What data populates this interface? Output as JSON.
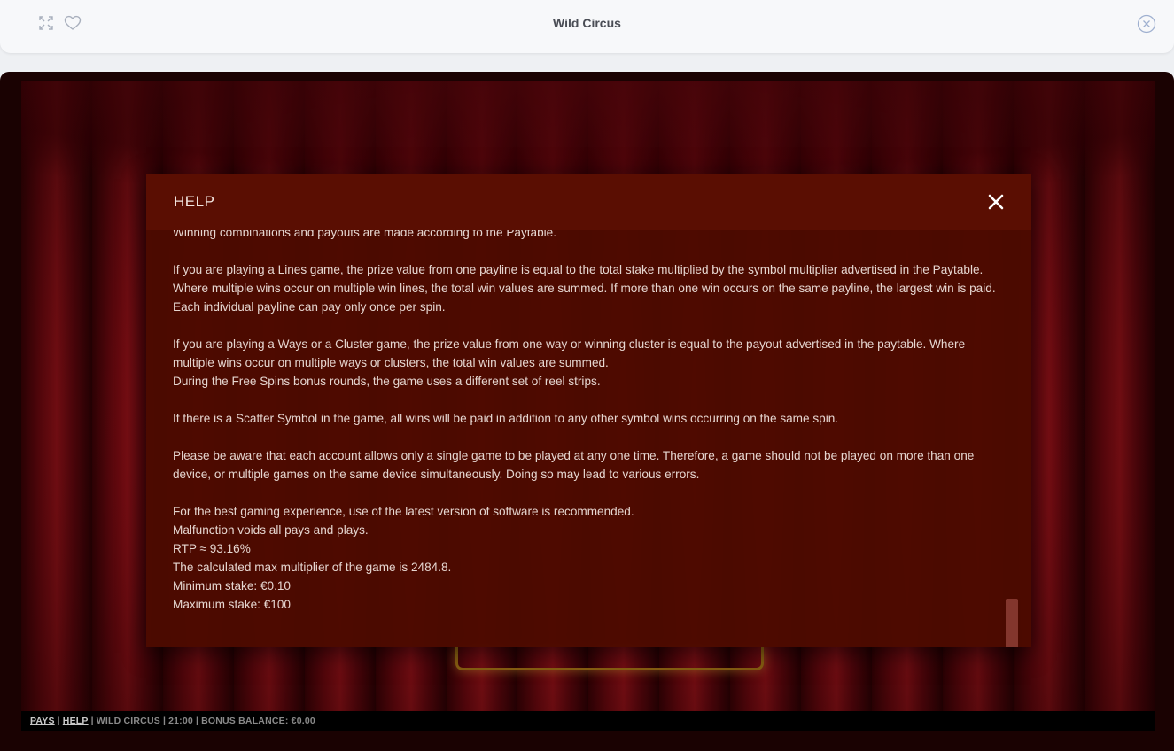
{
  "window": {
    "title": "Wild Circus",
    "icons": {
      "expand": "expand-icon",
      "favorite": "heart-icon",
      "close": "close-circle-icon"
    }
  },
  "help": {
    "title": "HELP",
    "paragraphs": [
      [
        "Winning combinations and payouts are made according to the Paytable."
      ],
      [
        "If you are playing a Lines game, the prize value from one payline is equal to the total stake multiplied by the symbol multiplier advertised in the Paytable. Where multiple wins occur on multiple win lines, the total win values are summed. If more than one win occurs on the same payline, the largest win is paid. Each individual payline can pay only once per spin."
      ],
      [
        "If you are playing a Ways or a Cluster game, the prize value from one way or winning cluster is equal to the payout advertised in the paytable. Where multiple wins occur on multiple ways or clusters, the total win values are summed.",
        "During the Free Spins bonus rounds, the game uses a different set of reel strips."
      ],
      [
        "If there is a Scatter Symbol in the game, all wins will be paid in addition to any other symbol wins occurring on the same spin."
      ],
      [
        "Please be aware that each account allows only a single game to be played at any one time. Therefore, a game should not be played on more than one device, or multiple games on the same device simultaneously. Doing so may lead to various errors."
      ],
      [
        "For the best gaming experience, use of the latest version of software is recommended.",
        "Malfunction voids all pays and plays.",
        "RTP ≈ 93.16%",
        "The calculated max multiplier of the game is 2484.8.",
        "Minimum stake: €0.10",
        "Maximum stake: €100"
      ]
    ]
  },
  "status_bar": {
    "pays": "PAYS",
    "help": "HELP",
    "game_name": "WILD CIRCUS",
    "time": "21:00",
    "bonus_balance": "BONUS BALANCE: €0.00"
  }
}
